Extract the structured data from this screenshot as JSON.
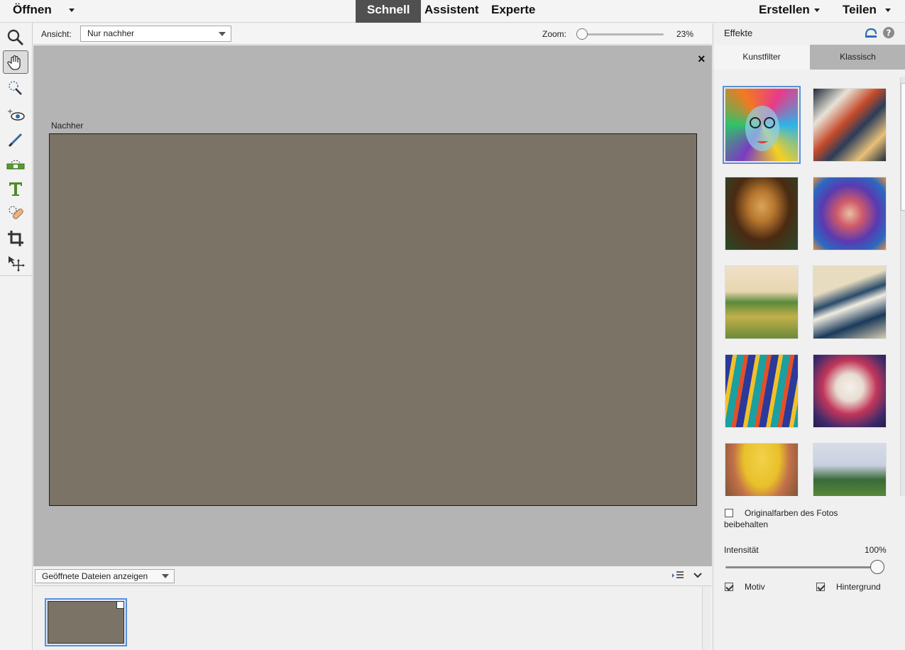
{
  "menu": {
    "open_label": "Öffnen",
    "modes": [
      "Schnell",
      "Assistent",
      "Experte"
    ],
    "active_mode": "Schnell",
    "create_label": "Erstellen",
    "share_label": "Teilen"
  },
  "toolbox": {
    "tools": [
      "zoom-tool",
      "hand-tool",
      "quick-selection-tool",
      "red-eye-tool",
      "whiten-teeth-tool",
      "straighten-tool",
      "type-tool",
      "spot-healing-tool",
      "crop-tool",
      "move-tool"
    ],
    "active_tool": "hand-tool"
  },
  "options": {
    "view_label": "Ansicht:",
    "view_value": "Nur nachher",
    "zoom_label": "Zoom:",
    "zoom_value": "23%",
    "zoom_level": 0.0
  },
  "canvas": {
    "view_title": "Nachher",
    "image_color": "#7a7366",
    "close_glyph": "×"
  },
  "photo_bin": {
    "dropdown_value": "Geöffnete Dateien anzeigen"
  },
  "panel": {
    "title": "Effekte",
    "tabs": [
      "Kunstfilter",
      "Klassisch"
    ],
    "active_tab": "Kunstfilter",
    "keep_colors_label_line1": "Originalfarben des Fotos",
    "keep_colors_label_line2": "beibehalten",
    "keep_colors_checked": false,
    "intensity_label": "Intensität",
    "intensity_value": "100%",
    "intensity_level": 1.0,
    "subject_label": "Motiv",
    "subject_checked": true,
    "background_label": "Hintergrund",
    "background_checked": true,
    "accent_color": "#5b8fd6"
  }
}
